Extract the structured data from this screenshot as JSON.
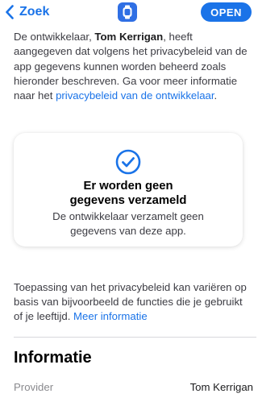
{
  "nav": {
    "back_label": "Zoek",
    "open_label": "OPEN"
  },
  "intro": {
    "part1": "De ontwikkelaar, ",
    "developer": "Tom Kerrigan",
    "part2": ", heeft aangegeven dat volgens het privacybeleid van de app gegevens kunnen worden beheerd zoals hieronder beschreven. Ga voor meer informatie naar het ",
    "link": "privacybeleid van de ontwikkelaar",
    "part3": "."
  },
  "card": {
    "icon": "checkmark-circle-icon",
    "title": "Er worden geen gegevens verzameld",
    "body": "De ontwikkelaar verzamelt geen gegevens van deze app."
  },
  "note": {
    "text": "Toepassing van het privacybeleid kan variëren op basis van bijvoorbeeld de functies die je gebruikt of je leeftijd. ",
    "link": "Meer informatie"
  },
  "info": {
    "title": "Informatie",
    "rows": [
      {
        "label": "Provider",
        "value": "Tom Kerrigan"
      }
    ]
  },
  "colors": {
    "accent": "#1a73e8",
    "app_icon": "#2f6fe4"
  }
}
